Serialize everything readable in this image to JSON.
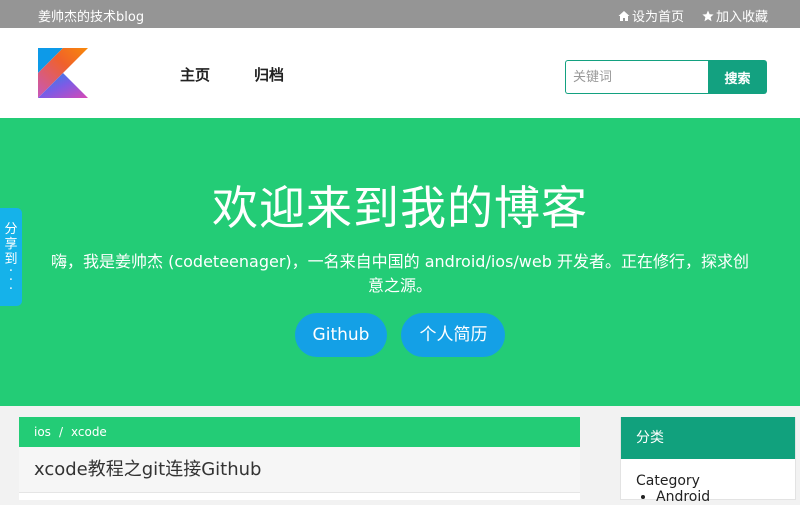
{
  "topbar": {
    "site_name": "姜帅杰的技术blog",
    "set_home": "设为首页",
    "bookmark": "加入收藏",
    "home_icon": "home-icon",
    "star_icon": "star-icon"
  },
  "header": {
    "logo": "kotlin-logo",
    "nav": [
      "主页",
      "归档"
    ],
    "search": {
      "placeholder": "关键词",
      "button": "搜索"
    }
  },
  "hero": {
    "title": "欢迎来到我的博客",
    "intro": "嗨，我是姜帅杰 (codeteenager)，一名来自中国的 android/ios/web 开发者。正在修行，探求创意之源。",
    "buttons": [
      "Github",
      "个人简历"
    ]
  },
  "share_tab": {
    "chars": [
      "分",
      "享",
      "到",
      "·",
      "·",
      "·"
    ]
  },
  "post": {
    "breadcrumb": [
      "ios",
      "xcode"
    ],
    "breadcrumb_sep": "/",
    "title": "xcode教程之git连接Github"
  },
  "sidebar": {
    "heading": "分类",
    "group_label": "Category",
    "items": [
      "Android"
    ]
  },
  "colors": {
    "topbar": "#959595",
    "hero": "#23cc76",
    "accent": "#13a180",
    "button": "#14a0e6",
    "share_tab": "#15b2ea"
  }
}
